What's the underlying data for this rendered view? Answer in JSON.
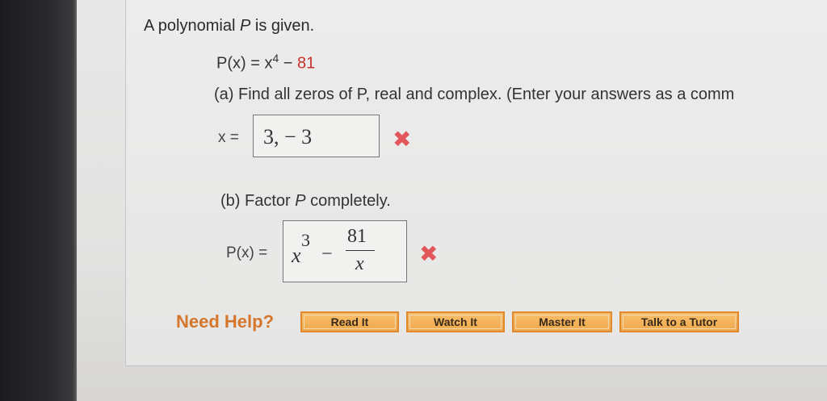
{
  "question": {
    "intro": {
      "before": "A polynomial ",
      "var": "P",
      "after": " is given."
    },
    "polynomial": {
      "lhs": "P(x) = x",
      "exp": "4",
      "op": " − ",
      "const": "81"
    },
    "part_a": {
      "prompt": "(a) Find all zeros of P, real and complex. (Enter your answers as a comm",
      "label": "x =",
      "answer": "3, − 3",
      "status_mark": "✖"
    },
    "part_b": {
      "prompt_before": "(b) Factor ",
      "prompt_var": "P",
      "prompt_after": " completely.",
      "label": "P(x) =",
      "answer": {
        "base": "x",
        "exp": "3",
        "op": "−",
        "numerator": "81",
        "denominator": "x"
      },
      "status_mark": "✖"
    }
  },
  "help": {
    "label": "Need Help?",
    "buttons": [
      "Read It",
      "Watch It",
      "Master It",
      "Talk to a Tutor"
    ]
  },
  "colors": {
    "incorrect": "#e2575b",
    "help": "#d5762d",
    "button": "#f3b35c",
    "constant": "#c8322c"
  },
  "icons": {
    "incorrect": "cross-mark-icon"
  }
}
